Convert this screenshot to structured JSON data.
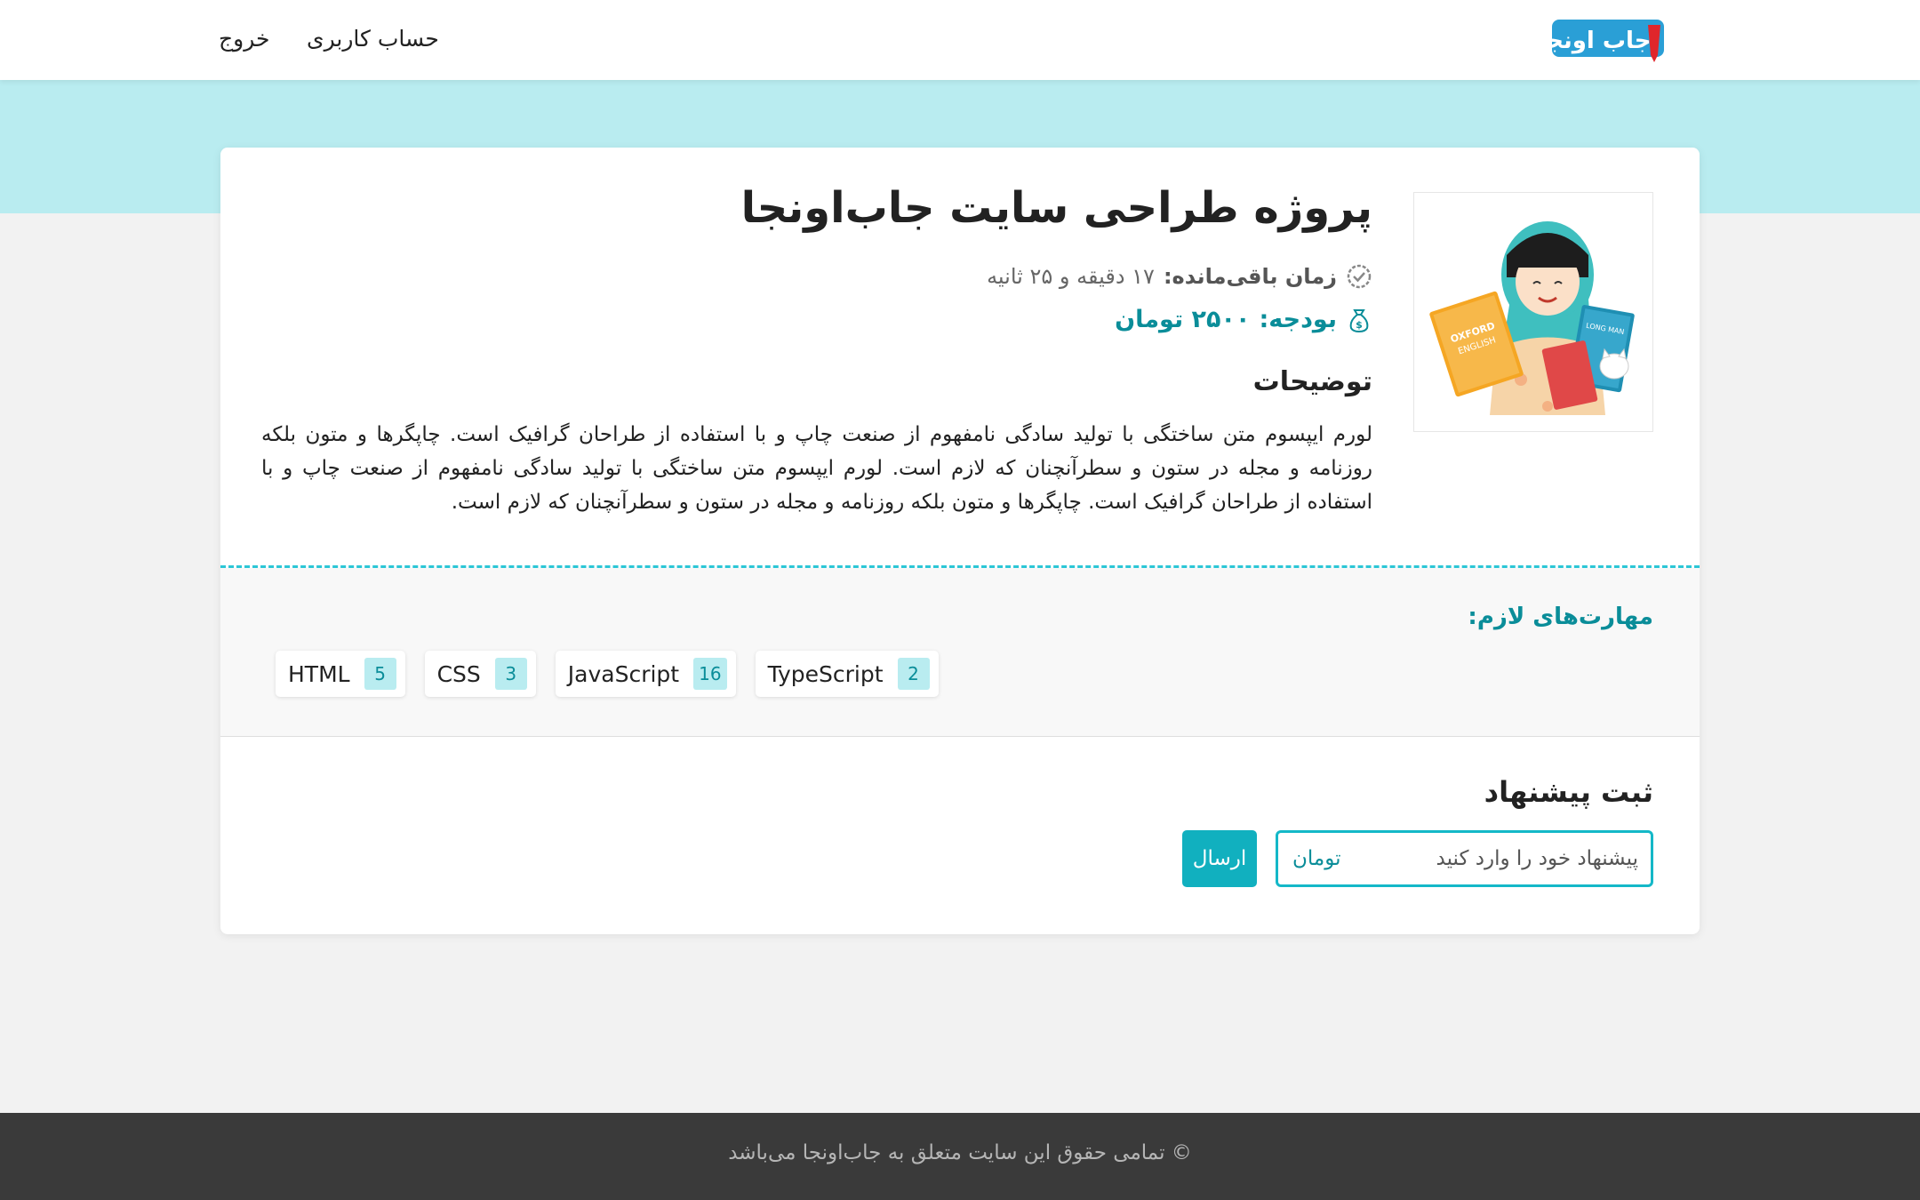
{
  "header": {
    "logo_text": "جاب اونجا",
    "nav": {
      "account": "حساب کاربری",
      "logout": "خروج"
    }
  },
  "project": {
    "title": "پروژه طراحی سایت جاب‌اونجا",
    "time_label": "زمان باقی‌مانده:",
    "time_value": "۱۷ دقیقه و ۲۵ ثانیه",
    "budget_label": "بودجه:",
    "budget_value": "۲۵۰۰ تومان",
    "description_heading": "توضیحات",
    "description": "لورم ایپسوم متن ساختگی با تولید سادگی نامفهوم از صنعت چاپ و با استفاده از طراحان گرافیک است. چاپگرها و متون بلکه روزنامه و مجله در ستون و سطرآنچنان که لازم است. لورم ایپسوم متن ساختگی با تولید سادگی نامفهوم از صنعت چاپ و با استفاده از طراحان گرافیک است. چاپگرها و متون بلکه روزنامه و مجله در ستون و سطرآنچنان که لازم است."
  },
  "skills": {
    "heading": "مهارت‌های لازم:",
    "items": [
      {
        "name": "HTML",
        "count": "5"
      },
      {
        "name": "CSS",
        "count": "3"
      },
      {
        "name": "JavaScript",
        "count": "16"
      },
      {
        "name": "TypeScript",
        "count": "2"
      }
    ]
  },
  "bid": {
    "heading": "ثبت پیشنهاد",
    "placeholder": "پیشنهاد خود را وارد کنید",
    "unit": "تومان",
    "submit_label": "ارسال"
  },
  "footer": {
    "text": "© تمامی حقوق این سایت متعلق به جاب‌اونجا می‌باشد"
  },
  "colors": {
    "accent": "#11b0bf",
    "accent_dark": "#0a8d99",
    "band": "#b9ecf0",
    "footer": "#3a3a3a"
  }
}
